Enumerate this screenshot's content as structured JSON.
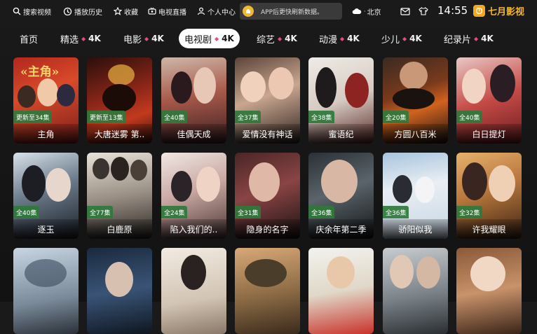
{
  "topbar": {
    "search": "搜索视频",
    "history": "播放历史",
    "favorites": "收藏",
    "live": "电视直播",
    "profile": "个人中心",
    "notice": "APP后更快刷新数据。",
    "weather": "北京",
    "time": "14:55",
    "brand": "七月影视"
  },
  "tabs": [
    {
      "label": "首页",
      "badge": ""
    },
    {
      "label": "精选",
      "badge": "4K"
    },
    {
      "label": "电影",
      "badge": "4K"
    },
    {
      "label": "电视剧",
      "badge": "4K"
    },
    {
      "label": "综艺",
      "badge": "4K"
    },
    {
      "label": "动漫",
      "badge": "4K"
    },
    {
      "label": "少儿",
      "badge": "4K"
    },
    {
      "label": "纪录片",
      "badge": "4K"
    }
  ],
  "active_tab": "电视剧",
  "rows": [
    [
      {
        "title": "主角",
        "episodes": "更新至34集",
        "poster_text": "«主角»"
      },
      {
        "title": "大唐迷雾 第..",
        "episodes": "更新至13集",
        "poster_text": ""
      },
      {
        "title": "佳偶天成",
        "episodes": "全40集",
        "poster_text": ""
      },
      {
        "title": "爱情没有神话",
        "episodes": "全37集",
        "poster_text": ""
      },
      {
        "title": "蜜语纪",
        "episodes": "全38集",
        "poster_text": ""
      },
      {
        "title": "方圆八百米",
        "episodes": "全20集",
        "poster_text": ""
      },
      {
        "title": "白日提灯",
        "episodes": "全40集",
        "poster_text": ""
      }
    ],
    [
      {
        "title": "逐玉",
        "episodes": "全40集",
        "poster_text": ""
      },
      {
        "title": "白鹿原",
        "episodes": "全77集",
        "poster_text": ""
      },
      {
        "title": "陷入我们的..",
        "episodes": "全24集",
        "poster_text": ""
      },
      {
        "title": "隐身的名字",
        "episodes": "全31集",
        "poster_text": ""
      },
      {
        "title": "庆余年第二季",
        "episodes": "全36集",
        "poster_text": ""
      },
      {
        "title": "骄阳似我",
        "episodes": "全36集",
        "poster_text": ""
      },
      {
        "title": "许我耀眼",
        "episodes": "全32集",
        "poster_text": ""
      }
    ],
    [
      {
        "title": "",
        "episodes": "",
        "poster_text": ""
      },
      {
        "title": "",
        "episodes": "",
        "poster_text": ""
      },
      {
        "title": "",
        "episodes": "",
        "poster_text": ""
      },
      {
        "title": "",
        "episodes": "",
        "poster_text": ""
      },
      {
        "title": "",
        "episodes": "",
        "poster_text": ""
      },
      {
        "title": "",
        "episodes": "",
        "poster_text": ""
      },
      {
        "title": "",
        "episodes": "",
        "poster_text": ""
      }
    ]
  ],
  "colors": {
    "accent": "#f5b630",
    "episode_badge": "#30783c",
    "tab_diamond": "#e84a7a",
    "background": "#141414"
  },
  "icons": [
    "search-icon",
    "history-icon",
    "star-icon",
    "tv-icon",
    "user-icon",
    "notice-icon",
    "cloud-icon",
    "mail-icon",
    "shirt-icon",
    "brand-logo-icon"
  ]
}
